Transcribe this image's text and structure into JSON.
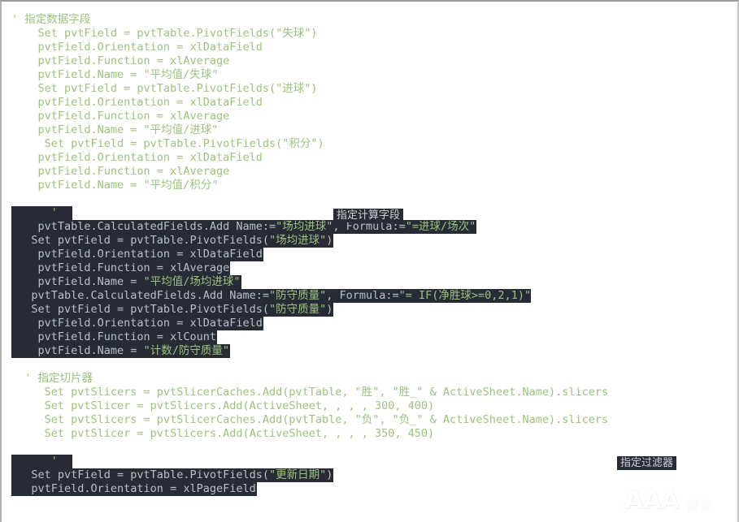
{
  "editor": {
    "background_color": "#ffffff",
    "comment_color": "#9dc27f",
    "code_color": "#9dc27f",
    "selection_background": "#272b35",
    "selection_text_color": "#b9c0cb",
    "font_size_px": 13.5,
    "line_height_px": 17
  },
  "annotations": {
    "data_field": "指定数据字段",
    "calc_field": "指定计算字段",
    "slicer": "指定切片器",
    "filter": "指定过滤器"
  },
  "watermark": {
    "letters": "AAA",
    "suffix": "教育"
  },
  "lines": [
    {
      "id": "l01",
      "indent": 0,
      "text": "' 指定数据字段",
      "sel": false
    },
    {
      "id": "l02",
      "indent": 0,
      "text": "    Set pvtField = pvtTable.PivotFields(\"失球\")",
      "sel": false
    },
    {
      "id": "l03",
      "indent": 0,
      "text": "    pvtField.Orientation = xlDataField",
      "sel": false
    },
    {
      "id": "l04",
      "indent": 0,
      "text": "    pvtField.Function = xlAverage",
      "sel": false
    },
    {
      "id": "l05",
      "indent": 0,
      "text": "    pvtField.Name = \"平均值/失球\"",
      "sel": false
    },
    {
      "id": "l06",
      "indent": 0,
      "text": "    Set pvtField = pvtTable.PivotFields(\"进球\")",
      "sel": false
    },
    {
      "id": "l07",
      "indent": 0,
      "text": "    pvtField.Orientation = xlDataField",
      "sel": false
    },
    {
      "id": "l08",
      "indent": 0,
      "text": "    pvtField.Function = xlAverage",
      "sel": false
    },
    {
      "id": "l09",
      "indent": 0,
      "text": "    pvtField.Name = \"平均值/进球\"",
      "sel": false
    },
    {
      "id": "l10",
      "indent": 0,
      "text": "     Set pvtField = pvtTable.PivotFields(\"积分\")",
      "sel": false
    },
    {
      "id": "l11",
      "indent": 0,
      "text": "    pvtField.Orientation = xlDataField",
      "sel": false
    },
    {
      "id": "l12",
      "indent": 0,
      "text": "    pvtField.Function = xlAverage",
      "sel": false
    },
    {
      "id": "l13",
      "indent": 0,
      "text": "    pvtField.Name = \"平均值/积分\"",
      "sel": false
    },
    {
      "id": "l14",
      "indent": 0,
      "text": "",
      "sel": false
    },
    {
      "id": "l15",
      "indent": 0,
      "text": "      '",
      "sel": false
    },
    {
      "id": "l16",
      "indent": 0,
      "text": "    pvtTable.CalculatedFields.Add Name:=\"场均进球\", Formula:=\"=进球/场次\"",
      "sel": true
    },
    {
      "id": "l17",
      "indent": 0,
      "text": "   Set pvtField = pvtTable.PivotFields(\"场均进球\")",
      "sel": true
    },
    {
      "id": "l18",
      "indent": 0,
      "text": "    pvtField.Orientation = xlDataField",
      "sel": true
    },
    {
      "id": "l19",
      "indent": 0,
      "text": "    pvtField.Function = xlAverage",
      "sel": true
    },
    {
      "id": "l20",
      "indent": 0,
      "text": "    pvtField.Name = \"平均值/场均进球\"",
      "sel": true
    },
    {
      "id": "l21",
      "indent": 0,
      "text": "   pvtTable.CalculatedFields.Add Name:=\"防守质量\", Formula:=\"= IF(净胜球>=0,2,1)\"",
      "sel": true
    },
    {
      "id": "l22",
      "indent": 0,
      "text": "   Set pvtField = pvtTable.PivotFields(\"防守质量\")",
      "sel": true
    },
    {
      "id": "l23",
      "indent": 0,
      "text": "    pvtField.Orientation = xlDataField",
      "sel": true
    },
    {
      "id": "l24",
      "indent": 0,
      "text": "    pvtField.Function = xlCount",
      "sel": true
    },
    {
      "id": "l25",
      "indent": 0,
      "text": "    pvtField.Name = \"计数/防守质量\"",
      "sel": true
    },
    {
      "id": "l26",
      "indent": 0,
      "text": "",
      "sel": false
    },
    {
      "id": "l27",
      "indent": 0,
      "text": "  ' 指定切片器",
      "sel": false
    },
    {
      "id": "l28",
      "indent": 0,
      "text": "     Set pvtSlicers = pvtSlicerCaches.Add(pvtTable, \"胜\", \"胜_\" & ActiveSheet.Name).slicers",
      "sel": false
    },
    {
      "id": "l29",
      "indent": 0,
      "text": "     Set pvtSlicer = pvtSlicers.Add(ActiveSheet, , , , 300, 400)",
      "sel": false
    },
    {
      "id": "l30",
      "indent": 0,
      "text": "     Set pvtSlicers = pvtSlicerCaches.Add(pvtTable, \"负\", \"负_\" & ActiveSheet.Name).slicers",
      "sel": false
    },
    {
      "id": "l31",
      "indent": 0,
      "text": "     Set pvtSlicer = pvtSlicers.Add(ActiveSheet, , , , 350, 450)",
      "sel": false
    },
    {
      "id": "l32",
      "indent": 0,
      "text": "",
      "sel": false
    },
    {
      "id": "l33",
      "indent": 0,
      "text": "      '",
      "sel": false
    },
    {
      "id": "l34",
      "indent": 0,
      "text": "   Set pvtField = pvtTable.PivotFields(\"更新日期\")",
      "sel": true
    },
    {
      "id": "l35",
      "indent": 0,
      "text": "   pvtField.Orientation = xlPageField",
      "sel": true
    }
  ]
}
